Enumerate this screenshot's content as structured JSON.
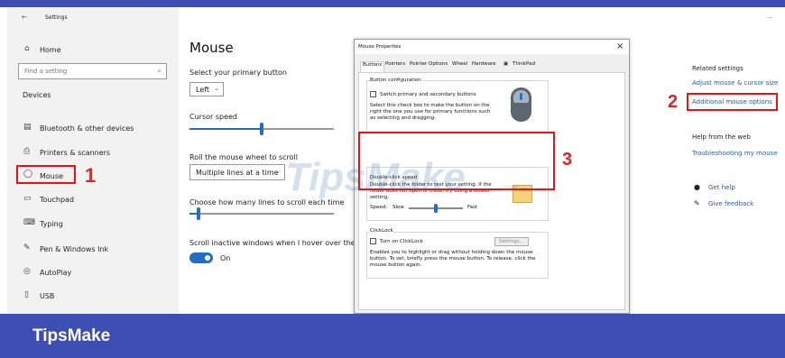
{
  "window": {
    "title": "Settings",
    "back_icon": "back-arrow-icon",
    "min_icon": "minimize-icon"
  },
  "sidebar": {
    "home": "Home",
    "search_placeholder": "Find a setting",
    "section": "Devices",
    "items": [
      {
        "label": "Bluetooth & other devices",
        "icon": "bluetooth-icon"
      },
      {
        "label": "Printers & scanners",
        "icon": "printer-icon"
      },
      {
        "label": "Mouse",
        "icon": "mouse-icon"
      },
      {
        "label": "Touchpad",
        "icon": "touchpad-icon"
      },
      {
        "label": "Typing",
        "icon": "keyboard-icon"
      },
      {
        "label": "Pen & Windows Ink",
        "icon": "pen-icon"
      },
      {
        "label": "AutoPlay",
        "icon": "autoplay-icon"
      },
      {
        "label": "USB",
        "icon": "usb-icon"
      }
    ]
  },
  "main": {
    "title": "Mouse",
    "primary_label": "Select your primary button",
    "primary_value": "Left",
    "cursor_label": "Cursor speed",
    "cursor_speed_fraction": 0.5,
    "wheel_label": "Roll the mouse wheel to scroll",
    "wheel_value": "Multiple lines at a time",
    "lines_label": "Choose how many lines to scroll each time",
    "lines_fraction": 0.06,
    "inactive_label": "Scroll inactive windows when I hover over them",
    "toggle_value": "On"
  },
  "dialog": {
    "title": "Mouse Properties",
    "close": "×",
    "tabs": [
      "Buttons",
      "Pointers",
      "Pointer Options",
      "Wheel",
      "Hardware",
      "ThinkPad"
    ],
    "button_config_title": "Button configuration",
    "switch_label": "Switch primary and secondary buttons",
    "switch_desc": [
      "Select this check box to make the button on the",
      "right the one you use for primary functions such",
      "as selecting and dragging."
    ],
    "dbl_title": "Double-click speed",
    "dbl_desc": [
      "Double-click the folder to test your setting. If the",
      "folder does not open or close, try using a slower",
      "setting."
    ],
    "speed_label": "Speed:",
    "slow": "Slow",
    "fast": "Fast",
    "speed_fraction": 0.5,
    "clicklock_title": "ClickLock",
    "clicklock_label": "Turn on ClickLock",
    "settings_button": "Settings...",
    "clicklock_desc": [
      "Enables you to highlight or drag without holding down the mouse",
      "button. To set, briefly press the mouse button. To release, click the",
      "mouse button again."
    ]
  },
  "related": {
    "title": "Related settings",
    "link1": "Adjust mouse & cursor size",
    "link2": "Additional mouse options",
    "help_title": "Help from the web",
    "help_link": "Troubleshooting my mouse",
    "get_help": "Get help",
    "feedback": "Give feedback"
  },
  "annotations": {
    "n1": "1",
    "n2": "2",
    "n3": "3"
  },
  "footer": {
    "brand": "TipsMake"
  },
  "watermark": {
    "text": "TipsMake",
    "suffix": ".com"
  },
  "colors": {
    "accent": "#1f6fc4",
    "banner": "#3d4fb2",
    "annotation": "#e11111"
  }
}
